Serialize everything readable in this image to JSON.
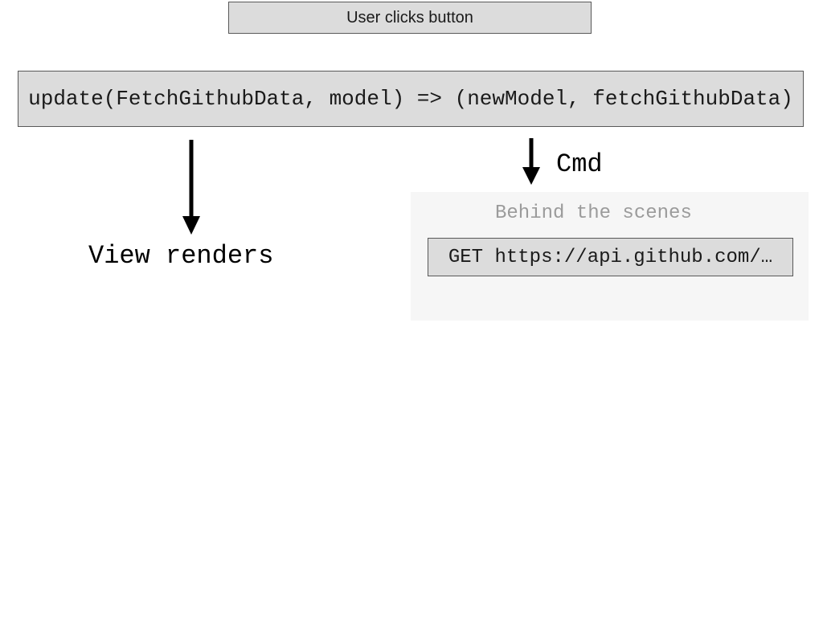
{
  "top_box": "User clicks button",
  "update_box": "update(FetchGithubData, model) => (newModel, fetchGithubData)",
  "view_renders": "View renders",
  "cmd_label": "Cmd",
  "behind_title": "Behind the scenes",
  "get_box": "GET https://api.github.com/…"
}
